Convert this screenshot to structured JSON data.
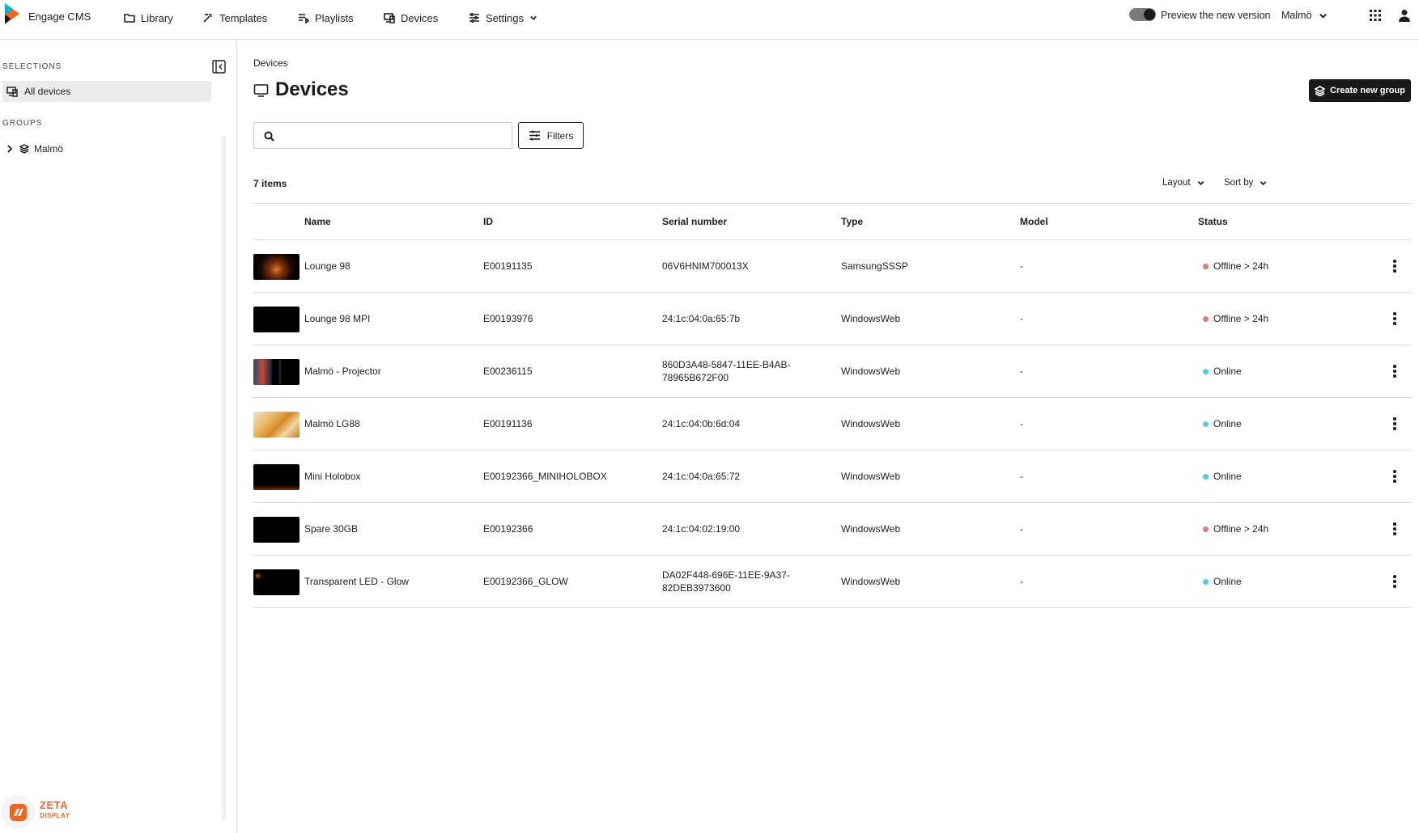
{
  "app": {
    "name": "Engage CMS",
    "accent_color": "#f26522",
    "logo_colors": [
      "#00b4d8",
      "#f26522"
    ]
  },
  "nav": {
    "items": [
      {
        "label": "Library",
        "icon": "folder-icon"
      },
      {
        "label": "Templates",
        "icon": "magic-wand-icon"
      },
      {
        "label": "Playlists",
        "icon": "playlist-icon"
      },
      {
        "label": "Devices",
        "icon": "devices-icon"
      },
      {
        "label": "Settings",
        "icon": "sliders-icon"
      }
    ],
    "preview_label": "Preview the new version",
    "preview_enabled": true,
    "org": "Malmö"
  },
  "sidebar": {
    "selections_label": "SELECTIONS",
    "all_devices": "All devices",
    "groups_label": "GROUPS",
    "groups": [
      {
        "label": "Malmö"
      }
    ],
    "footer_logo": {
      "line1": "ZETA",
      "line2": "DISPLAY"
    }
  },
  "main": {
    "breadcrumb": "Devices",
    "title": "Devices",
    "create_button": "Create new group",
    "search_placeholder": "",
    "filters_label": "Filters",
    "item_count": "7 items",
    "layout_label": "Layout",
    "sort_label": "Sort by"
  },
  "table": {
    "columns": [
      "Name",
      "ID",
      "Serial number",
      "Type",
      "Model",
      "Status"
    ],
    "rows": [
      {
        "name": "Lounge 98",
        "id": "E00191135",
        "serial": "06V6HNIM700013X",
        "type": "SamsungSSSP",
        "model": "-",
        "status": "Offline > 24h",
        "status_color": "#e07a7a"
      },
      {
        "name": "Lounge 98 MPI",
        "id": "E00193976",
        "serial": "24:1c:04:0a:65:7b",
        "type": "WindowsWeb",
        "model": "-",
        "status": "Offline > 24h",
        "status_color": "#e07a7a"
      },
      {
        "name": "Malmö - Projector",
        "id": "E00236115",
        "serial": "860D3A48-5847-11EE-B4AB-78965B672F00",
        "type": "WindowsWeb",
        "model": "-",
        "status": "Online",
        "status_color": "#4fd1d9"
      },
      {
        "name": "Malmö LG88",
        "id": "E00191136",
        "serial": "24:1c:04:0b:6d:04",
        "type": "WindowsWeb",
        "model": "-",
        "status": "Online",
        "status_color": "#4fd1d9"
      },
      {
        "name": "Mini Holobox",
        "id": "E00192366_MINIHOLOBOX",
        "serial": "24:1c:04:0a:65:72",
        "type": "WindowsWeb",
        "model": "-",
        "status": "Online",
        "status_color": "#4fd1d9"
      },
      {
        "name": "Spare 30GB",
        "id": "E00192366",
        "serial": "24:1c:04:02:19:00",
        "type": "WindowsWeb",
        "model": "-",
        "status": "Offline > 24h",
        "status_color": "#e07a7a"
      },
      {
        "name": "Transparent LED - Glow",
        "id": "E00192366_GLOW",
        "serial": "DA02F448-696E-11EE-9A37-82DEB3973600",
        "type": "WindowsWeb",
        "model": "-",
        "status": "Online",
        "status_color": "#4fd1d9"
      }
    ]
  }
}
